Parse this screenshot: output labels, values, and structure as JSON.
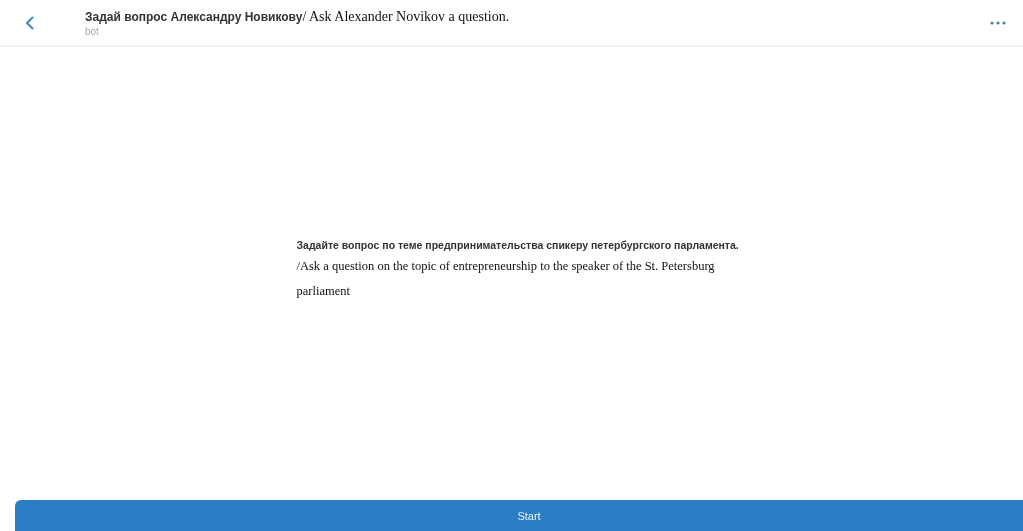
{
  "header": {
    "title": "Задай вопрос Александру Новикову",
    "title_translation": "/ Ask Alexander Novikov a question.",
    "subtitle": "bot"
  },
  "description": {
    "text": "Задайте вопрос по теме предпринимательства спикеру петербургского парламента.",
    "translation": "/Ask a question on the topic of entrepreneurship to the speaker of the St. Petersburg parliament"
  },
  "start_button": {
    "label": "Start"
  }
}
